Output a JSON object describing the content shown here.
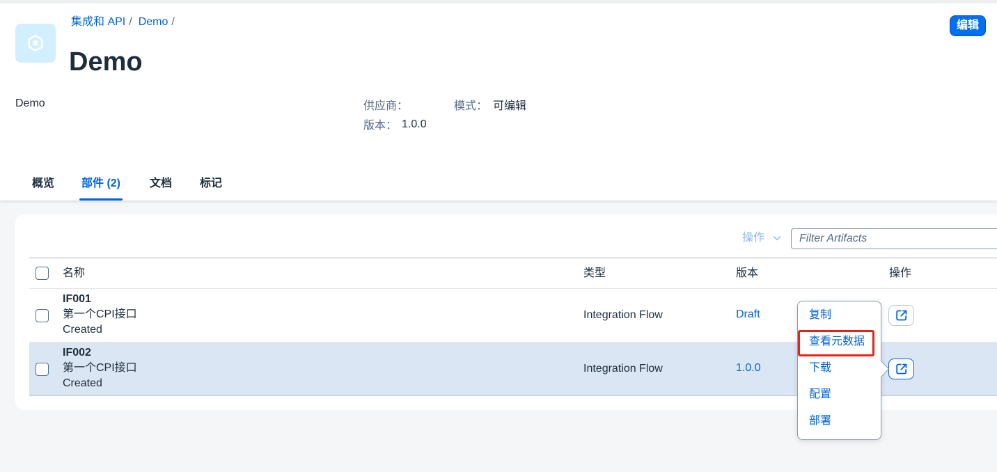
{
  "header": {
    "icon": "integration-package-icon",
    "breadcrumb": [
      "集成和 API",
      "Demo"
    ],
    "breadcrumb_separator": "/",
    "title": "Demo",
    "edit_button": "编辑",
    "description": "Demo",
    "attributes": {
      "vendor_label": "供应商：",
      "mode_label": "模式：",
      "mode_value": "可编辑",
      "version_label": "版本：",
      "version_value": "1.0.0"
    }
  },
  "tabs": [
    {
      "label": "概览"
    },
    {
      "label": "部件 (2)",
      "selected": true
    },
    {
      "label": "文档"
    },
    {
      "label": "标记"
    }
  ],
  "toolbar": {
    "actions_label": "操作",
    "actions_icon": "chevron-down-icon",
    "filter_placeholder": "Filter Artifacts"
  },
  "table": {
    "columns": [
      "名称",
      "类型",
      "版本",
      "操作"
    ],
    "rows": [
      {
        "id": "IF001",
        "name": "第一个CPI接口",
        "status": "Created",
        "type": "Integration Flow",
        "version": "Draft",
        "action_icon": "action-menu-icon"
      },
      {
        "id": "IF002",
        "name": "第一个CPI接口",
        "status": "Created",
        "type": "Integration Flow",
        "version": "1.0.0",
        "action_icon": "action-menu-icon",
        "highlighted": true
      }
    ]
  },
  "action_menu": {
    "items": [
      {
        "label": "复制"
      },
      {
        "label": "查看元数据",
        "annotated": true
      },
      {
        "label": "下载"
      },
      {
        "label": "配置"
      },
      {
        "label": "部署"
      }
    ]
  },
  "colors": {
    "accent": "#0064d9",
    "edit_button_bg": "#0070f2",
    "header_icon_bg": "#d1efff",
    "page_bg": "#f5f6f7",
    "row_highlight_bg": "#dae6f3",
    "disabled_text": "#8fb7ea",
    "annotation_red": "#e3241b",
    "text": "#1d2d3e",
    "label_text": "#556b82"
  }
}
